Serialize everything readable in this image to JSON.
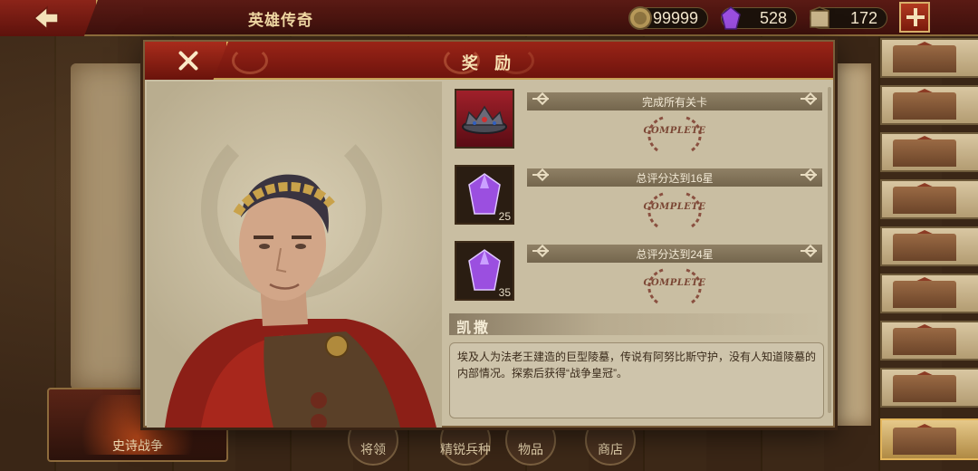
{
  "topbar": {
    "title": "英雄传奇",
    "coins": "99999",
    "gems": "528",
    "medals": "172"
  },
  "dialog": {
    "title": "奖 励",
    "rewards": [
      {
        "text": "完成所有关卡",
        "item": "crown",
        "count": "",
        "status": "COMPLETE"
      },
      {
        "text": "总评分达到16星",
        "item": "purple-gem",
        "count": "25",
        "status": "COMPLETE"
      },
      {
        "text": "总评分达到24星",
        "item": "purple-gem",
        "count": "35",
        "status": "COMPLETE"
      }
    ],
    "hero_name": "凯撒",
    "description": "埃及人为法老王建造的巨型陵墓，传说有阿努比斯守护，没有人知道陵墓的内部情况。探索后获得“战争皇冠”。"
  },
  "bottom_menu": {
    "epic_war": "史诗战争",
    "tabs": [
      "将领",
      "精锐兵种",
      "物品",
      "商店"
    ]
  },
  "colors": {
    "header_red": "#8c2419",
    "parchment": "#c9bea2",
    "gold": "#c9a25a",
    "gem_purple": "#9b4fe0"
  }
}
